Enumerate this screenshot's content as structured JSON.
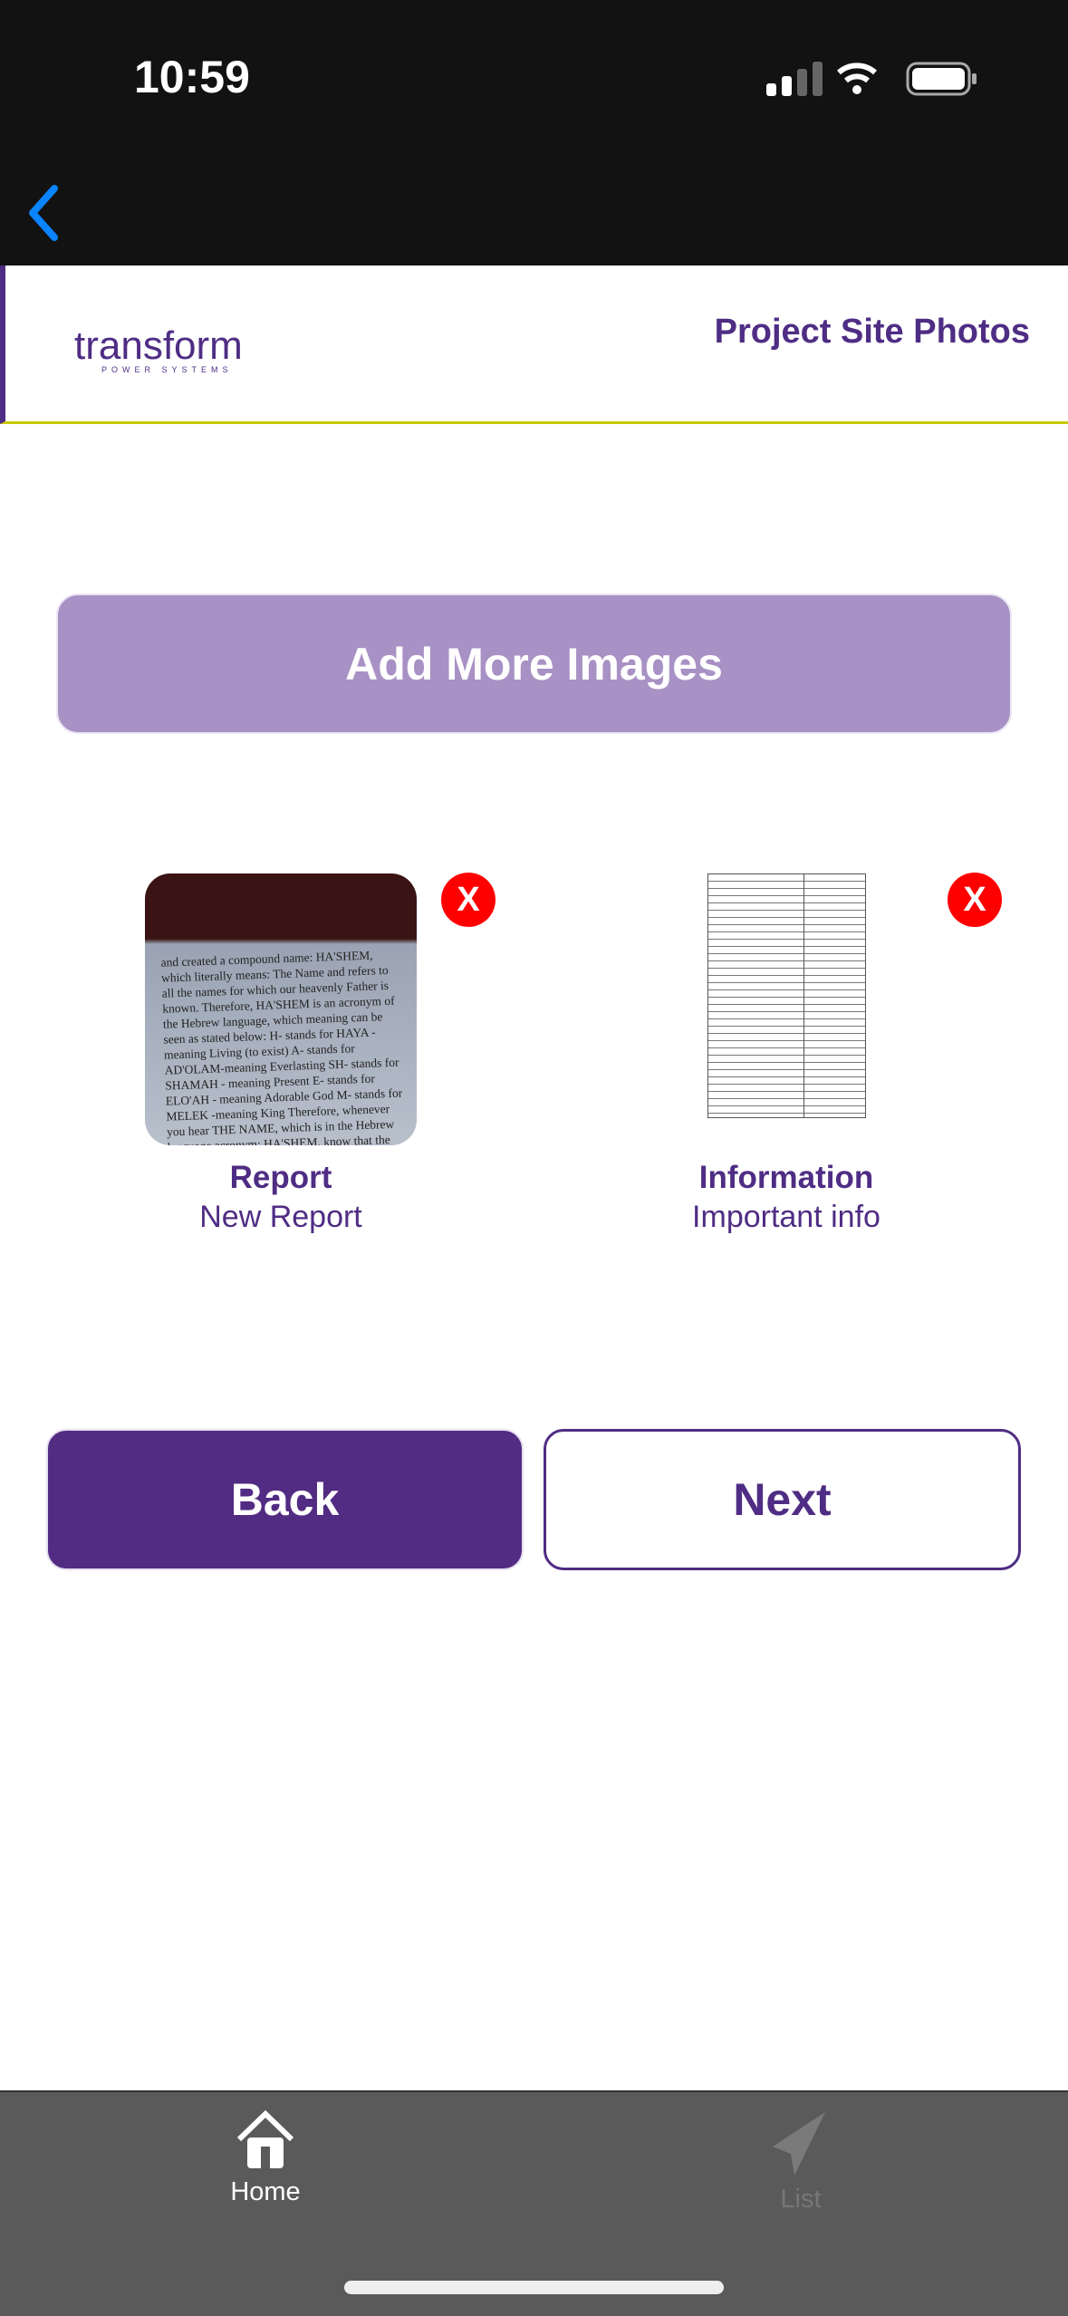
{
  "status_bar": {
    "time": "10:59"
  },
  "header": {
    "logo_word": "transform",
    "logo_sub": "POWER SYSTEMS",
    "title": "Project Site Photos"
  },
  "add_button": "Add More Images",
  "images": [
    {
      "title": "Report",
      "subtitle": "New Report",
      "remove": "X",
      "excerpt": "and created a compound name: HA'SHEM, which literally means: The Name and refers to all the names for which our heavenly Father is known. Therefore, HA'SHEM is an acronym of the Hebrew language, which meaning can be seen as stated below: H- stands for HAYA -meaning Living (to exist) A- stands for AD'OLAM-meaning Everlasting SH- stands for SHAMAH - meaning Present E- stands for ELO'AH - meaning Adorable God M- stands for MELEK -meaning King Therefore, whenever you hear THE NAME, which is in the Hebrew language acronym: HA'SHEM, know that the person is talking about HAYAH, AD'OLAM, SHAMAH, ELO'AH, MELEK, which means THE LIVING, EVERLASTING, PRESENT, MOST ADORABLE, KING. Blessed be the name of the Lord. This has become our anthem in The Community of HASHEM. Amen! 8. God does things for His name's sake: One of the major errors of Christianity is that their doctrine teaches that God does not act except the name of Jesus"
    },
    {
      "title": "Information",
      "subtitle": "Important info",
      "remove": "X"
    }
  ],
  "buttons": {
    "back": "Back",
    "next": "Next"
  },
  "tabs": [
    {
      "label": "Home",
      "icon": "home-icon",
      "active": true
    },
    {
      "label": "List",
      "icon": "paper-plane-icon",
      "active": false
    }
  ],
  "colors": {
    "brand": "#4f2d84",
    "accent_line": "#c9c900",
    "add_button": "#a891c4",
    "remove": "#ff0000"
  }
}
